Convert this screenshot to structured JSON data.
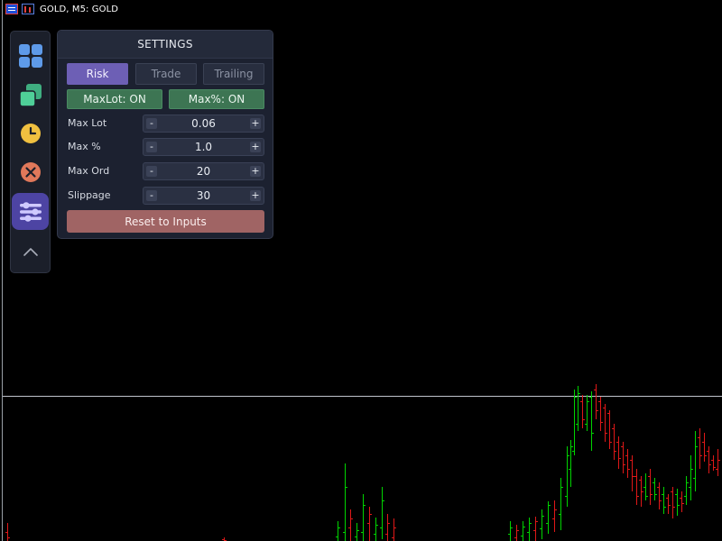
{
  "chart_window": {
    "title": "GOLD, M5:  GOLD",
    "icons": [
      "list-icon",
      "bars-icon"
    ],
    "background_color": "#000000",
    "bull_color": "#00d400",
    "bear_color": "#e01818",
    "price_line_color": "#c0c4cc"
  },
  "toolbar": {
    "items": [
      {
        "name": "grid-icon",
        "color": "#5e9ae8",
        "active": false
      },
      {
        "name": "copy-icon",
        "color": "#4fcf98",
        "active": false
      },
      {
        "name": "clock-icon",
        "color": "#f0c040",
        "active": false
      },
      {
        "name": "close-circle-icon",
        "color": "#e0785a",
        "active": false
      },
      {
        "name": "sliders-icon",
        "color": "#cfc9ff",
        "active": true
      },
      {
        "name": "chevron-up-icon",
        "color": "#a8acb8",
        "active": false
      }
    ]
  },
  "panel": {
    "title": "SETTINGS",
    "tabs": [
      {
        "label": "Risk",
        "active": true
      },
      {
        "label": "Trade",
        "active": false
      },
      {
        "label": "Trailing",
        "active": false
      }
    ],
    "toggles": [
      {
        "label": "MaxLot: ON"
      },
      {
        "label": "Max%: ON"
      }
    ],
    "rows": [
      {
        "label": "Max Lot",
        "value": "0.06",
        "minus": "-",
        "plus": "+"
      },
      {
        "label": "Max %",
        "value": "1.0",
        "minus": "-",
        "plus": "+"
      },
      {
        "label": "Max Ord",
        "value": "20",
        "minus": "-",
        "plus": "+"
      },
      {
        "label": "Slippage",
        "value": "30",
        "minus": "-",
        "plus": "+"
      }
    ],
    "reset_label": "Reset to Inputs"
  }
}
